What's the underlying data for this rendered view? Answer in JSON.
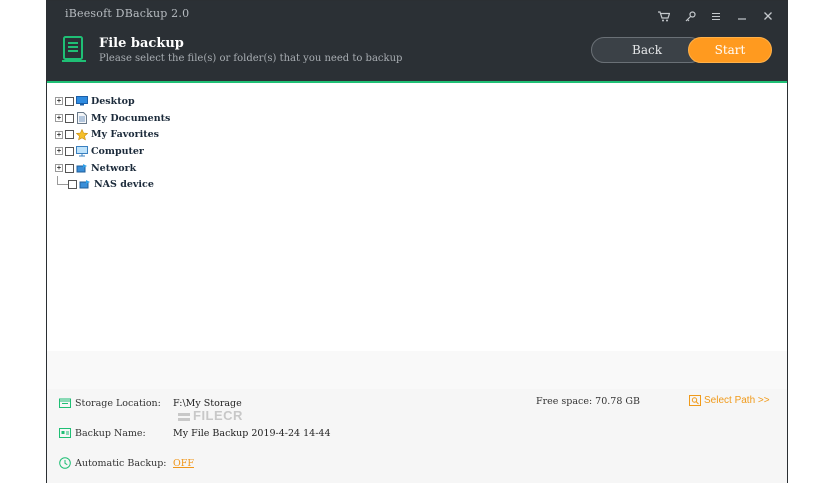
{
  "app": {
    "window_title": "iBeesoft DBackup 2.0",
    "controls": [
      "cart-icon",
      "key-icon",
      "menu-icon",
      "minimize-icon",
      "close-icon"
    ]
  },
  "header": {
    "title": "File backup",
    "subtitle": "Please select the file(s) or folder(s) that you need to backup",
    "back_label": "Back",
    "start_label": "Start",
    "accent_color": "#1fbf75",
    "start_color": "#ff9a1f"
  },
  "tree": {
    "items": [
      {
        "label": "Desktop",
        "icon": "desktop-icon"
      },
      {
        "label": "My Documents",
        "icon": "documents-icon"
      },
      {
        "label": "My Favorites",
        "icon": "favorites-star-icon"
      },
      {
        "label": "Computer",
        "icon": "computer-icon"
      },
      {
        "label": "Network",
        "icon": "network-icon"
      },
      {
        "label": "NAS device",
        "icon": "nas-device-icon"
      }
    ]
  },
  "footer": {
    "storage_label": "Storage Location:",
    "storage_value": "F:\\My Storage",
    "free_space": "Free space: 70.78 GB",
    "select_path": "Select Path >>",
    "backup_name_label": "Backup Name:",
    "backup_name_value": "My File Backup 2019-4-24 14-44",
    "auto_backup_label": "Automatic Backup:",
    "auto_backup_value": "OFF"
  },
  "watermark": "FILECR"
}
